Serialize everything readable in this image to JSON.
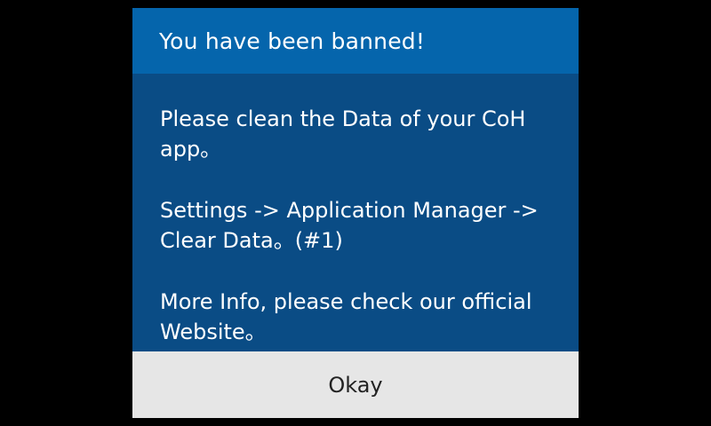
{
  "dialog": {
    "title": "You have been banned!",
    "paragraphs": [
      "Please clean the Data of your CoH app。",
      "Settings -> Application Manager -> Clear Data。(#1)",
      "More Info, please check our official Website。"
    ],
    "ok_label": "Okay"
  },
  "colors": {
    "header": "#0565ac",
    "body": "#0a4c85",
    "footer": "#e6e6e6",
    "backdrop": "#000000"
  }
}
